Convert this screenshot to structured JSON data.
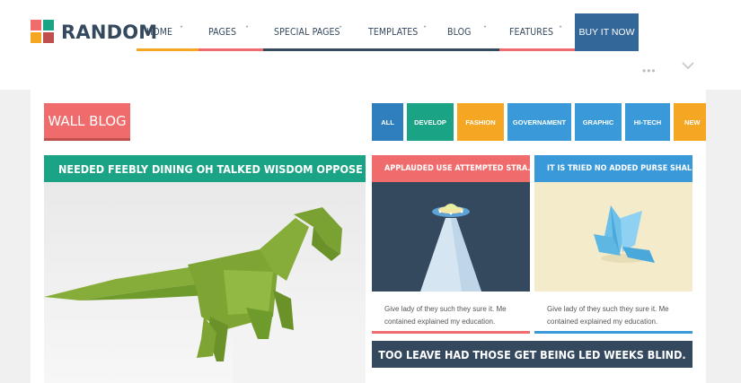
{
  "brand": {
    "name": "RANDOM"
  },
  "nav": {
    "items": [
      {
        "label": "HOME",
        "accent": "#f5a623"
      },
      {
        "label": "PAGES",
        "accent": "#f06c6c"
      },
      {
        "label": "SPECIAL PAGES",
        "accent": "#34495e"
      },
      {
        "label": "TEMPLATES",
        "accent": "#34495e"
      },
      {
        "label": "BLOG",
        "accent": "#34495e"
      },
      {
        "label": "FEATURES",
        "accent": "#f06c6c"
      }
    ],
    "caret": "ˇ",
    "buy_label": "BUY IT NOW"
  },
  "header_tools": {
    "dots": "•••"
  },
  "wall": {
    "title": "WALL BLOG"
  },
  "filters": [
    {
      "label": "ALL",
      "color": "#2f7fbf"
    },
    {
      "label": "DEVELOP",
      "color": "#1aa384"
    },
    {
      "label": "FASHION",
      "color": "#f5a623"
    },
    {
      "label": "GOVERNAMENT",
      "color": "#3a9ad9"
    },
    {
      "label": "GRAPHIC",
      "color": "#3a9ad9"
    },
    {
      "label": "HI-TECH",
      "color": "#3a9ad9"
    },
    {
      "label": "NEW",
      "color": "#f5a623"
    }
  ],
  "posts": {
    "featured": {
      "title": "NEEDED FEEBLY DINING OH TALKED WISDOM OPPOSE AT."
    },
    "card1": {
      "title": "APPLAUDED USE ATTEMPTED STRA...",
      "excerpt": "Give lady of they such they sure it. Me contained explained my education."
    },
    "card2": {
      "title": "IT IS TRIED NO ADDED PURSE SHAL...",
      "excerpt": "Give lady of they such they sure it. Me contained explained my education."
    },
    "banner": {
      "title": "TOO LEAVE HAD THOSE GET BEING LED WEEKS BLIND."
    }
  },
  "colors": {
    "brand_dark": "#34495e",
    "red": "#f06c6c",
    "green": "#1aa384",
    "blue": "#3a9ad9",
    "orange": "#f5a623"
  }
}
